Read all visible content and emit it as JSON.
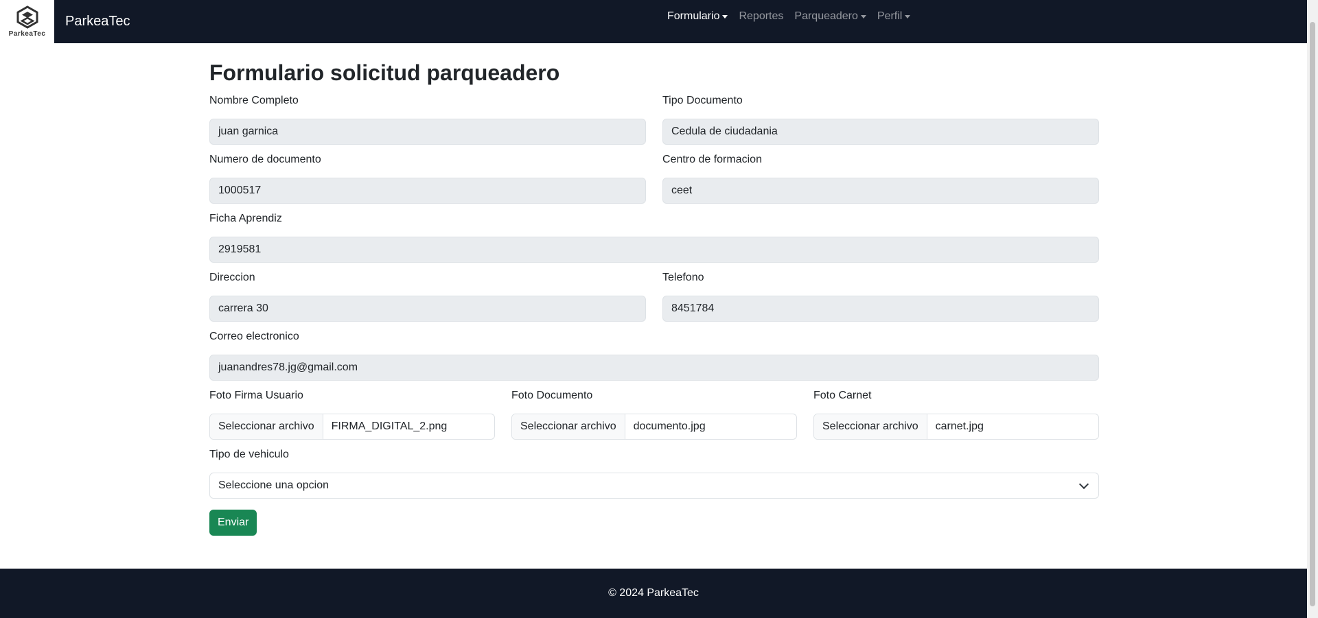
{
  "navbar": {
    "logo_text": "ParkeaTec",
    "brand": "ParkeaTec",
    "links": [
      {
        "label": "Formulario",
        "dropdown": true,
        "active": true
      },
      {
        "label": "Reportes",
        "dropdown": false,
        "active": false
      },
      {
        "label": "Parqueadero",
        "dropdown": true,
        "active": false
      },
      {
        "label": "Perfil",
        "dropdown": true,
        "active": false
      }
    ]
  },
  "form": {
    "title": "Formulario solicitud parqueadero",
    "nombre": {
      "label": "Nombre Completo",
      "value": "juan garnica"
    },
    "tipo_documento": {
      "label": "Tipo Documento",
      "value": "Cedula de ciudadania"
    },
    "numero_documento": {
      "label": "Numero de documento",
      "value": "1000517"
    },
    "centro": {
      "label": "Centro de formacion",
      "value": "ceet"
    },
    "ficha": {
      "label": "Ficha Aprendiz",
      "value": "2919581"
    },
    "direccion": {
      "label": "Direccion",
      "value": "carrera 30"
    },
    "telefono": {
      "label": "Telefono",
      "value": "8451784"
    },
    "correo": {
      "label": "Correo electronico",
      "value": "juanandres78.jg@gmail.com"
    },
    "foto_firma": {
      "label": "Foto Firma Usuario",
      "button": "Seleccionar archivo",
      "file": "FIRMA_DIGITAL_2.png"
    },
    "foto_documento": {
      "label": "Foto Documento",
      "button": "Seleccionar archivo",
      "file": "documento.jpg"
    },
    "foto_carnet": {
      "label": "Foto Carnet",
      "button": "Seleccionar archivo",
      "file": "carnet.jpg"
    },
    "tipo_vehiculo": {
      "label": "Tipo de vehiculo",
      "selected": "Seleccione una opcion"
    },
    "submit": "Enviar"
  },
  "footer": {
    "text": "© 2024 ParkeaTec"
  },
  "colors": {
    "navbar": "#111827",
    "submit": "#198754",
    "readonly_input": "#e9ecef"
  }
}
